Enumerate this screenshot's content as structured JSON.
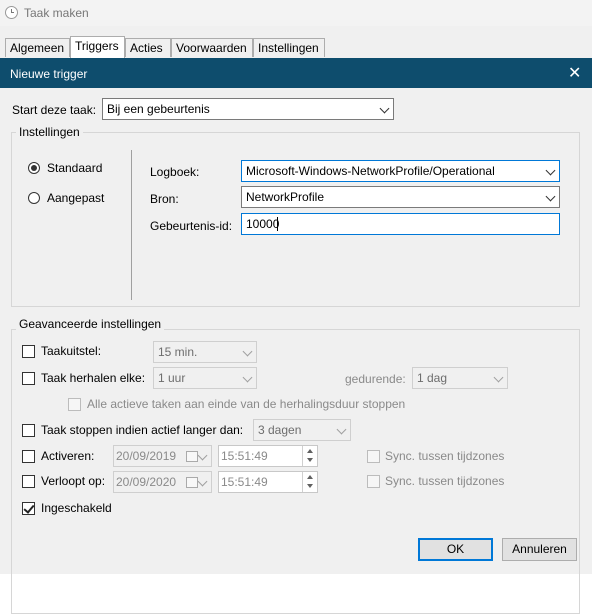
{
  "parent_window": {
    "title": "Taak maken"
  },
  "tabs": [
    {
      "label": "Algemeen"
    },
    {
      "label": "Triggers"
    },
    {
      "label": "Acties"
    },
    {
      "label": "Voorwaarden"
    },
    {
      "label": "Instellingen"
    }
  ],
  "dialog": {
    "title": "Nieuwe trigger",
    "close_glyph": "✕",
    "start_label": "Start deze taak:",
    "start_value": "Bij een gebeurtenis",
    "settings_group": {
      "title": "Instellingen",
      "radio_standard": "Standaard",
      "radio_custom": "Aangepast",
      "log_label": "Logboek:",
      "log_value": "Microsoft-Windows-NetworkProfile/Operational",
      "source_label": "Bron:",
      "source_value": "NetworkProfile",
      "event_id_label": "Gebeurtenis-id:",
      "event_id_value": "10000"
    },
    "advanced_group": {
      "title": "Geavanceerde instellingen",
      "delay_label": "Taakuitstel:",
      "delay_value": "15 min.",
      "repeat_label": "Taak herhalen elke:",
      "repeat_value": "1 uur",
      "duration_label": "gedurende:",
      "duration_value": "1 dag",
      "stop_all_label": "Alle actieve taken aan einde van de herhalingsduur stoppen",
      "stop_if_label": "Taak stoppen indien actief langer dan:",
      "stop_if_value": "3 dagen",
      "activate_label": "Activeren:",
      "activate_date": "20/09/2019",
      "activate_time": "15:51:49",
      "expire_label": "Verloopt op:",
      "expire_date": "20/09/2020",
      "expire_time": "15:51:49",
      "sync_label_1": "Sync. tussen tijdzones",
      "sync_label_2": "Sync. tussen tijdzones",
      "enabled_label": "Ingeschakeld"
    },
    "ok_label": "OK",
    "cancel_label": "Annuleren"
  },
  "colors": {
    "title_bar": "#0e4d6d",
    "focus_border": "#0078d7",
    "dialog_bg": "#f0f0f0"
  }
}
